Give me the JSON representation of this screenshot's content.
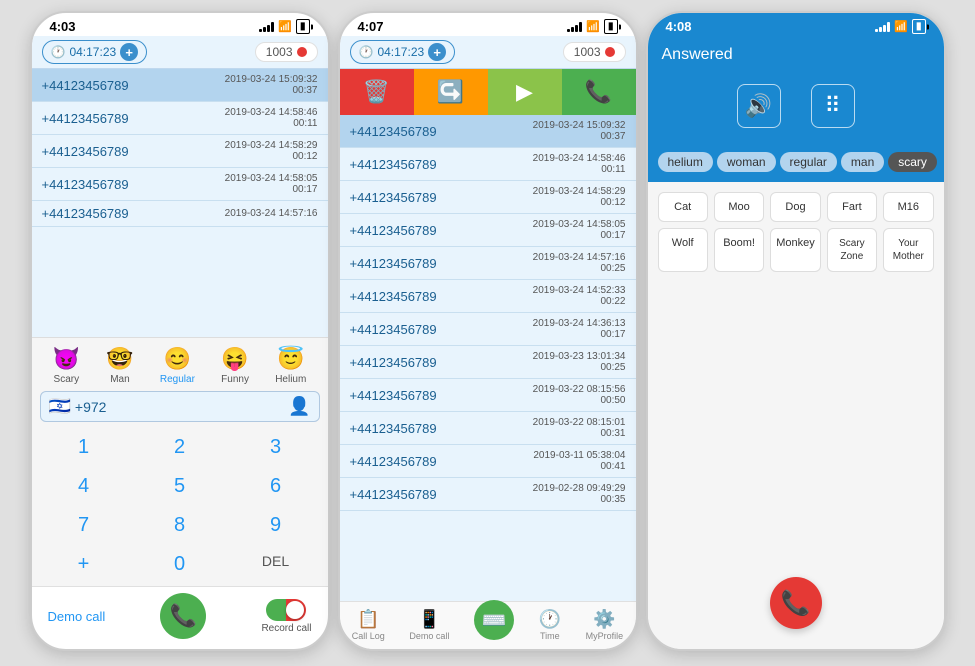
{
  "phone1": {
    "status_time": "4:03",
    "timer": "04:17:23",
    "count": "1003",
    "calls": [
      {
        "number": "+44123456789",
        "date": "2019-03-24 15:09:32",
        "duration": "00:37"
      },
      {
        "number": "+44123456789",
        "date": "2019-03-24 14:58:46",
        "duration": "00:11"
      },
      {
        "number": "+44123456789",
        "date": "2019-03-24 14:58:29",
        "duration": "00:12"
      },
      {
        "number": "+44123456789",
        "date": "2019-03-24 14:58:05",
        "duration": "00:17"
      },
      {
        "number": "+44123456789",
        "date": "2019-03-24 14:57:16",
        "duration": ""
      }
    ],
    "voice_filters": [
      {
        "label": "Scary",
        "icon": "😈"
      },
      {
        "label": "Man",
        "icon": "🤓"
      },
      {
        "label": "Regular",
        "icon": "😊"
      },
      {
        "label": "Funny",
        "icon": "😝"
      },
      {
        "label": "Helium",
        "icon": "😇"
      }
    ],
    "prefix": "+972",
    "dialpad": [
      "1",
      "2",
      "3",
      "4",
      "5",
      "6",
      "7",
      "8",
      "9",
      "+",
      "0",
      "DEL"
    ],
    "demo_call": "Demo call",
    "record_call": "Record call"
  },
  "phone2": {
    "status_time": "4:07",
    "timer": "04:17:23",
    "count": "1003",
    "action_buttons": [
      {
        "icon": "🗑️",
        "color": "red"
      },
      {
        "icon": "↪️",
        "color": "orange"
      },
      {
        "icon": "▶️",
        "color": "green-light"
      },
      {
        "icon": "📞",
        "color": "green"
      }
    ],
    "calls": [
      {
        "number": "+44123456789",
        "date": "2019-03-24 15:09:32",
        "duration": "00:37"
      },
      {
        "number": "+44123456789",
        "date": "2019-03-24 14:58:46",
        "duration": "00:11"
      },
      {
        "number": "+44123456789",
        "date": "2019-03-24 14:58:29",
        "duration": "00:12"
      },
      {
        "number": "+44123456789",
        "date": "2019-03-24 14:58:05",
        "duration": "00:17"
      },
      {
        "number": "+44123456789",
        "date": "2019-03-24 14:57:16",
        "duration": "00:25"
      },
      {
        "number": "+44123456789",
        "date": "2019-03-24 14:52:33",
        "duration": "00:22"
      },
      {
        "number": "+44123456789",
        "date": "2019-03-24 14:36:13",
        "duration": "00:17"
      },
      {
        "number": "+44123456789",
        "date": "2019-03-23 13:01:34",
        "duration": "00:25"
      },
      {
        "number": "+44123456789",
        "date": "2019-03-22 08:15:56",
        "duration": "00:50"
      },
      {
        "number": "+44123456789",
        "date": "2019-03-22 08:15:01",
        "duration": "00:31"
      },
      {
        "number": "+44123456789",
        "date": "2019-03-11 05:38:04",
        "duration": "00:41"
      },
      {
        "number": "+44123456789",
        "date": "2019-02-28 09:49:29",
        "duration": "00:35"
      }
    ],
    "tabs": [
      {
        "label": "Call Log",
        "icon": "📋"
      },
      {
        "label": "Demo call",
        "icon": "📱"
      },
      {
        "label": "",
        "icon": "⌨️",
        "center": true
      },
      {
        "label": "Time",
        "icon": "🕐"
      },
      {
        "label": "MyProfile",
        "icon": "⚙️"
      }
    ]
  },
  "phone3": {
    "status_time": "4:08",
    "answered_label": "Answered",
    "speaker_buttons": [
      {
        "icon": "🔊"
      },
      {
        "icon": "⠿"
      }
    ],
    "voice_filters": [
      "helium",
      "woman",
      "regular",
      "man",
      "scary"
    ],
    "active_filter": "scary",
    "sound_grid_row1": [
      "Cat",
      "Moo",
      "Dog",
      "Fart",
      "M16"
    ],
    "sound_grid_row2": [
      "Wolf",
      "Boom!",
      "Monkey",
      "Scary Zone",
      "Your Mother"
    ],
    "end_call_icon": "📞"
  }
}
